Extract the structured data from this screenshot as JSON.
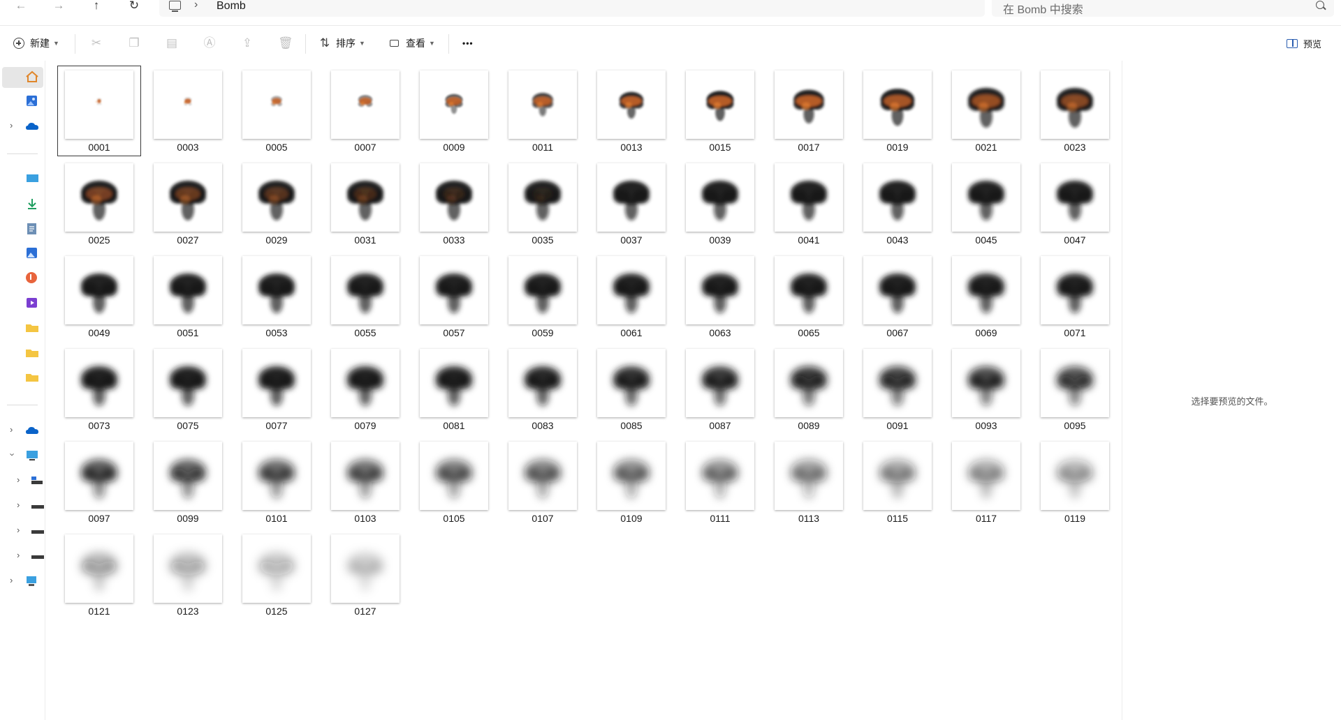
{
  "address_bar": {
    "crumb_sep": "›",
    "folder": "Bomb",
    "search_placeholder": "在 Bomb 中搜索"
  },
  "toolbar": {
    "new_label": "新建",
    "sort_label": "排序",
    "view_label": "查看",
    "more_label": "•••",
    "preview_label": "预览"
  },
  "preview_pane": {
    "message": "选择要预览的文件。"
  },
  "files": [
    "0001",
    "0003",
    "0005",
    "0007",
    "0009",
    "0011",
    "0013",
    "0015",
    "0017",
    "0019",
    "0021",
    "0023",
    "0025",
    "0027",
    "0029",
    "0031",
    "0033",
    "0035",
    "0037",
    "0039",
    "0041",
    "0043",
    "0045",
    "0047",
    "0049",
    "0051",
    "0053",
    "0055",
    "0057",
    "0059",
    "0061",
    "0063",
    "0065",
    "0067",
    "0069",
    "0071",
    "0073",
    "0075",
    "0077",
    "0079",
    "0081",
    "0083",
    "0085",
    "0087",
    "0089",
    "0091",
    "0093",
    "0095",
    "0097",
    "0099",
    "0101",
    "0103",
    "0105",
    "0107",
    "0109",
    "0111",
    "0113",
    "0115",
    "0117",
    "0119",
    "0121",
    "0123",
    "0125",
    "0127"
  ],
  "selected_file": "0001",
  "colors": {
    "accent": "#2a5db0",
    "fire": "#c8642a",
    "smoke": "#141414",
    "home_icon": "#e0862a",
    "onedrive": "#0a63c9"
  }
}
